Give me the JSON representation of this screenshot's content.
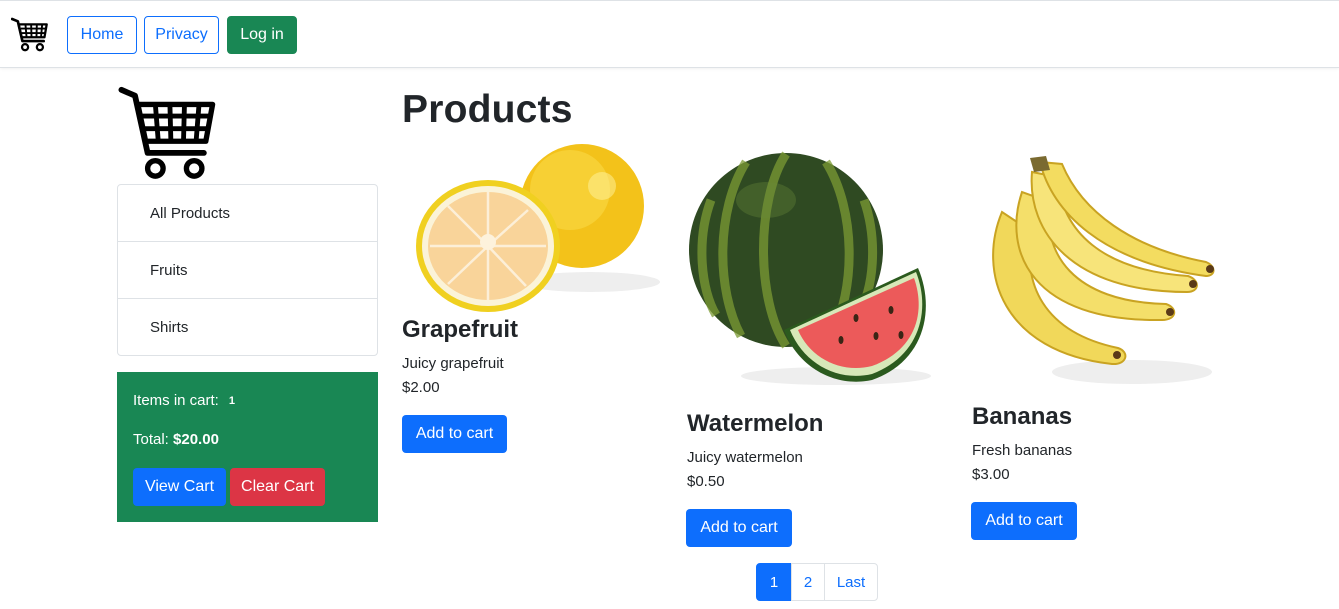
{
  "navbar": {
    "logo_icon": "shopping-cart-icon",
    "home_label": "Home",
    "privacy_label": "Privacy",
    "login_label": "Log in"
  },
  "sidebar": {
    "logo_icon": "shopping-cart-icon",
    "categories": [
      {
        "label": "All Products"
      },
      {
        "label": "Fruits"
      },
      {
        "label": "Shirts"
      }
    ],
    "cart": {
      "items_label": "Items in cart:",
      "items_count": "1",
      "total_label": "Total:",
      "total_value": "$20.00",
      "view_cart_label": "View Cart",
      "clear_cart_label": "Clear Cart"
    }
  },
  "main": {
    "title": "Products",
    "products": [
      {
        "name": "Grapefruit",
        "description": "Juicy grapefruit",
        "price": "$2.00",
        "button_label": "Add to cart",
        "image": "grapefruit-image"
      },
      {
        "name": "Watermelon",
        "description": "Juicy watermelon",
        "price": "$0.50",
        "button_label": "Add to cart",
        "image": "watermelon-image"
      },
      {
        "name": "Bananas",
        "description": "Fresh bananas",
        "price": "$3.00",
        "button_label": "Add to cart",
        "image": "bananas-image"
      }
    ],
    "pagination": {
      "pages": [
        "1",
        "2"
      ],
      "active_page": "1",
      "last_label": "Last"
    }
  },
  "colors": {
    "primary": "#0d6efd",
    "success": "#198754",
    "danger": "#dc3545",
    "text": "#212529"
  }
}
